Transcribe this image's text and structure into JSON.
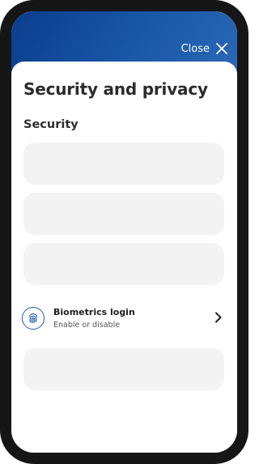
{
  "header": {
    "close_label": "Close"
  },
  "page": {
    "title": "Security and privacy",
    "section_title": "Security"
  },
  "items": [
    {
      "title": "Biometrics login",
      "subtitle": "Enable or disable"
    }
  ],
  "colors": {
    "header_gradient_start": "#0b3d8e",
    "header_gradient_end": "#2a6ab7",
    "accent": "#1d5aa8",
    "placeholder": "#f3f3f3"
  },
  "icons": {
    "close": "close-icon",
    "biometrics": "fingerprint-icon",
    "chevron": "chevron-right-icon"
  }
}
